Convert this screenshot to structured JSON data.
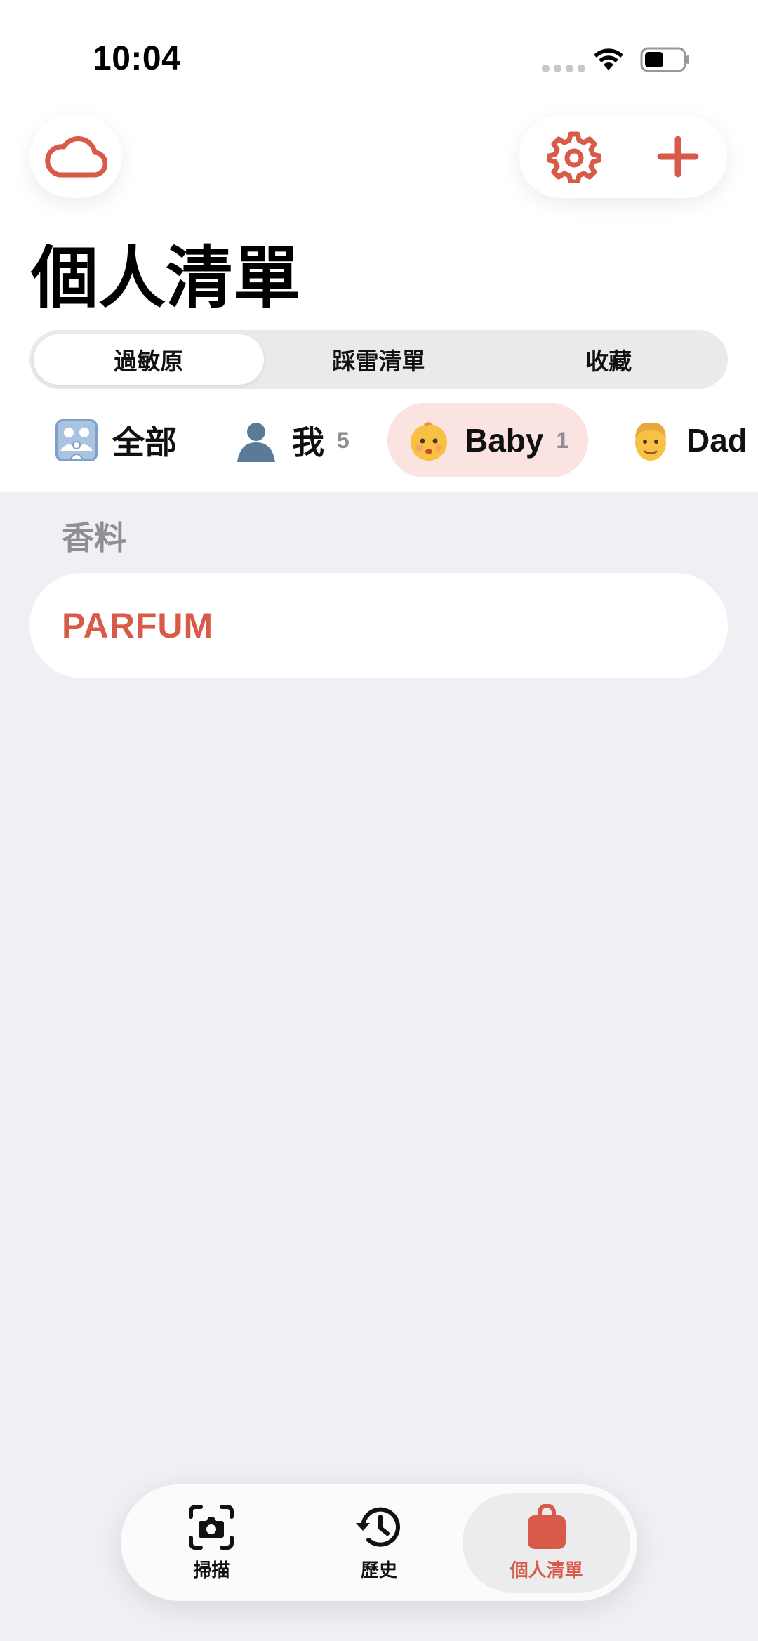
{
  "status_bar": {
    "time": "10:04"
  },
  "header": {
    "title": "個人清單",
    "icons": {
      "cloud": "cloud-icon",
      "settings": "gear-icon",
      "add": "plus-icon"
    }
  },
  "segments": [
    {
      "label": "過敏原",
      "active": true
    },
    {
      "label": "踩雷清單",
      "active": false
    },
    {
      "label": "收藏",
      "active": false
    }
  ],
  "profiles": [
    {
      "emoji": "family-icon",
      "name": "全部",
      "count": "",
      "active": false
    },
    {
      "emoji": "person-silhouette-icon",
      "name": "我",
      "count": "5",
      "active": false
    },
    {
      "emoji": "baby-icon",
      "name": "Baby",
      "count": "1",
      "active": true
    },
    {
      "emoji": "man-icon",
      "name": "Dad",
      "count": "",
      "active": false
    }
  ],
  "section": {
    "title": "香料",
    "items": [
      "PARFUM"
    ]
  },
  "tabbar": [
    {
      "label": "掃描",
      "icon": "camera-scan-icon",
      "active": false
    },
    {
      "label": "歷史",
      "icon": "history-clock-icon",
      "active": false
    },
    {
      "label": "個人清單",
      "icon": "bag-icon",
      "active": true
    }
  ],
  "colors": {
    "accent": "#d85a48",
    "background": "#f0eff4",
    "chip_active": "#fae3e0"
  }
}
